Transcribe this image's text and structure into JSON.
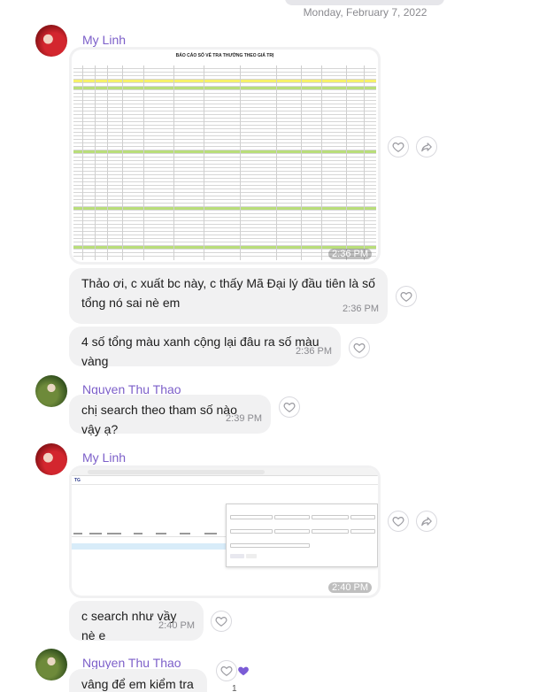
{
  "date_separator": "Monday, February 7, 2022",
  "messages": {
    "m1": {
      "sender": "My Linh",
      "image_report": {
        "title": "BÁO CÁO SỐ VÉ TRA THƯỜNG THEO GIÁ TRỊ",
        "time": "2:36 PM"
      }
    },
    "m2": {
      "text": "Thảo ơi, c xuất bc này, c thấy Mã Đại lý đầu tiên là số tổng nó sai nè em",
      "time": "2:36 PM"
    },
    "m3": {
      "text": "4 số tổng màu xanh cộng lại đâu ra số màu vàng",
      "time": "2:36 PM"
    },
    "m4": {
      "sender": "Nguyen Thu Thao",
      "text": "chị search theo tham số nào vậy ạ?",
      "time": "2:39 PM"
    },
    "m5": {
      "sender": "My Linh",
      "image_app": {
        "time": "2:40 PM"
      }
    },
    "m6": {
      "text": "c search như vầy nè e",
      "time": "2:40 PM"
    },
    "m7": {
      "sender": "Nguyen Thu Thao",
      "text": "vâng để em kiểm tra ạ",
      "reaction_count": "1"
    }
  },
  "icons": {
    "heart": "heart-icon",
    "share": "share-icon",
    "heart_filled": "heart-filled-icon"
  },
  "colors": {
    "sender_name": "#7c5fc9",
    "bubble_bg": "#f1f1f2",
    "reaction_purple": "#7b5cd6"
  }
}
